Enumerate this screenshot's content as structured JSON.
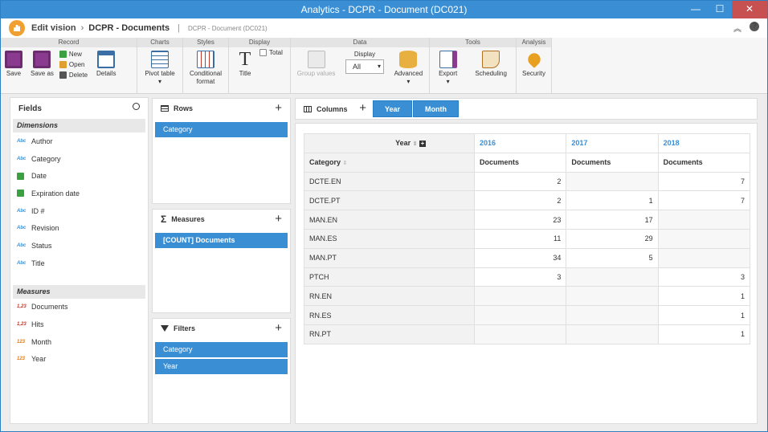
{
  "window": {
    "title": "Analytics - DCPR - Document (DC021)",
    "minimize": "—",
    "maximize": "☐",
    "close": "✕"
  },
  "header": {
    "edit_vision": "Edit vision",
    "arrow": "›",
    "title": "DCPR - Documents",
    "separator": "|",
    "subtitle": "DCPR - Document (DC021)",
    "collapse": "︽",
    "help": "?"
  },
  "ribbon": {
    "record": {
      "label": "Record",
      "save": "Save",
      "save_as": "Save as",
      "new": "New",
      "open": "Open",
      "delete": "Delete",
      "details": "Details"
    },
    "charts": {
      "label": "Charts",
      "pivot": "Pivot table",
      "dropdown": "▾"
    },
    "styles": {
      "label": "Styles",
      "conditional": "Conditional format"
    },
    "display": {
      "label": "Display",
      "title": "Title",
      "total": "Total"
    },
    "data": {
      "label": "Data",
      "group_values": "Group values",
      "display_label": "Display",
      "display_value": "All",
      "advanced": "Advanced",
      "dropdown": "▾"
    },
    "tools": {
      "label": "Tools",
      "export": "Export",
      "scheduling": "Scheduling",
      "dropdown": "▾"
    },
    "analysis": {
      "label": "Analysis",
      "security": "Security"
    }
  },
  "fields": {
    "title": "Fields",
    "dimensions_label": "Dimensions",
    "dimensions": [
      {
        "type": "Abc",
        "label": "Author"
      },
      {
        "type": "Abc",
        "label": "Category"
      },
      {
        "type": "date",
        "label": "Date"
      },
      {
        "type": "date",
        "label": "Expiration date"
      },
      {
        "type": "Abc",
        "label": "ID #"
      },
      {
        "type": "Abc",
        "label": "Revision"
      },
      {
        "type": "Abc",
        "label": "Status"
      },
      {
        "type": "Abc",
        "label": "Title"
      }
    ],
    "measures_label": "Measures",
    "measures": [
      {
        "type": "1,23",
        "label": "Documents"
      },
      {
        "type": "1,23",
        "label": "Hits"
      },
      {
        "type": "123",
        "label": "Month"
      },
      {
        "type": "123",
        "label": "Year"
      }
    ]
  },
  "rows_panel": {
    "title": "Rows",
    "plus": "+",
    "items": [
      "Category"
    ]
  },
  "measures_panel": {
    "title": "Measures",
    "plus": "+",
    "items": [
      "[COUNT] Documents"
    ]
  },
  "filters_panel": {
    "title": "Filters",
    "plus": "+",
    "items": [
      "Category",
      "Year"
    ]
  },
  "columns_bar": {
    "title": "Columns",
    "plus": "+",
    "buttons": [
      "Year",
      "Month"
    ]
  },
  "pivot": {
    "year_label": "Year",
    "category_label": "Category",
    "years": [
      "2016",
      "2017",
      "2018"
    ],
    "measure": "Documents",
    "rows": [
      {
        "cat": "DCTE.EN",
        "v": [
          "2",
          "",
          "7"
        ]
      },
      {
        "cat": "DCTE.PT",
        "v": [
          "2",
          "1",
          "7"
        ]
      },
      {
        "cat": "MAN.EN",
        "v": [
          "23",
          "17",
          ""
        ]
      },
      {
        "cat": "MAN.ES",
        "v": [
          "11",
          "29",
          ""
        ]
      },
      {
        "cat": "MAN.PT",
        "v": [
          "34",
          "5",
          ""
        ]
      },
      {
        "cat": "PTCH",
        "v": [
          "3",
          "",
          "3"
        ]
      },
      {
        "cat": "RN.EN",
        "v": [
          "",
          "",
          "1"
        ]
      },
      {
        "cat": "RN.ES",
        "v": [
          "",
          "",
          "1"
        ]
      },
      {
        "cat": "RN.PT",
        "v": [
          "",
          "",
          "1"
        ]
      }
    ]
  }
}
